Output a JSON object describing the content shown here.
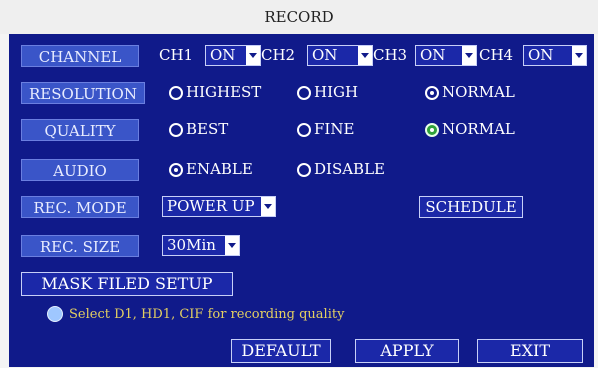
{
  "window": {
    "title": "RECORD"
  },
  "channel": {
    "label": "CHANNEL",
    "items": [
      {
        "name": "CH1",
        "value": "ON"
      },
      {
        "name": "CH2",
        "value": "ON"
      },
      {
        "name": "CH3",
        "value": "ON"
      },
      {
        "name": "CH4",
        "value": "ON"
      }
    ]
  },
  "resolution": {
    "label": "RESOLUTION",
    "options": [
      "HIGHEST",
      "HIGH",
      "NORMAL"
    ],
    "selected": "NORMAL"
  },
  "quality": {
    "label": "QUALITY",
    "options": [
      "BEST",
      "FINE",
      "NORMAL"
    ],
    "selected": "NORMAL"
  },
  "audio": {
    "label": "AUDIO",
    "options": [
      "ENABLE",
      "DISABLE"
    ],
    "selected": "ENABLE"
  },
  "rec_mode": {
    "label": "REC. MODE",
    "value": "POWER UP",
    "schedule_label": "SCHEDULE"
  },
  "rec_size": {
    "label": "REC. SIZE",
    "value": "30Min"
  },
  "mask": {
    "label": "MASK FILED SETUP"
  },
  "hint": {
    "text": "Select D1, HD1, CIF for recording quality"
  },
  "buttons": {
    "default": "DEFAULT",
    "apply": "APPLY",
    "exit": "EXIT"
  },
  "colors": {
    "panel": "#101a8a",
    "label_bg": "#3a55c8",
    "hint": "#e3cf62",
    "selected_green": "#2fa23a"
  }
}
